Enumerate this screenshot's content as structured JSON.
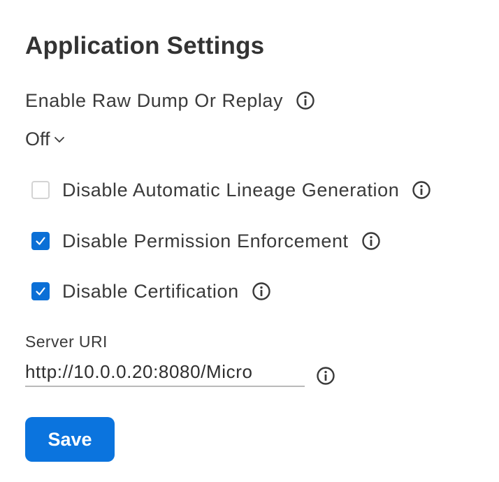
{
  "page": {
    "title": "Application Settings"
  },
  "raw_dump": {
    "label": "Enable Raw Dump Or Replay",
    "selected": "Off",
    "info_icon": "info-circle-icon"
  },
  "options": [
    {
      "label": "Disable Automatic Lineage Generation",
      "checked": false,
      "info_icon": "info-circle-icon"
    },
    {
      "label": "Disable Permission Enforcement",
      "checked": true,
      "info_icon": "info-circle-icon"
    },
    {
      "label": "Disable Certification",
      "checked": true,
      "info_icon": "info-circle-icon"
    }
  ],
  "server_uri": {
    "label": "Server URI",
    "value": "http://10.0.0.20:8080/Micro",
    "info_icon": "info-circle-icon"
  },
  "actions": {
    "save_label": "Save"
  },
  "colors": {
    "accent": "#0b74de",
    "checkbox_checked": "#0b6fd6",
    "text": "#3a3a3a"
  }
}
